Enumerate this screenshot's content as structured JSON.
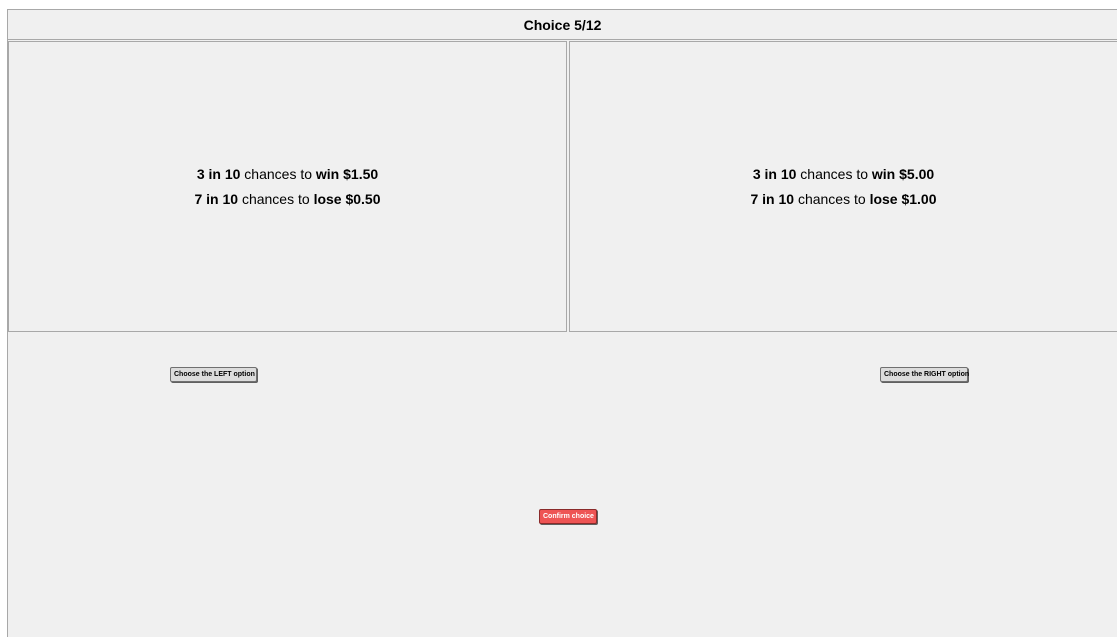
{
  "header": {
    "title": "Choice 5/12"
  },
  "left_option": {
    "win": {
      "odds": "3 in 10",
      "mid": " chances to ",
      "verb": "win",
      "amount": "$1.50"
    },
    "lose": {
      "odds": "7 in 10",
      "mid": " chances to ",
      "verb": "lose",
      "amount": "$0.50"
    }
  },
  "right_option": {
    "win": {
      "odds": "3 in 10",
      "mid": " chances to ",
      "verb": "win",
      "amount": "$5.00"
    },
    "lose": {
      "odds": "7 in 10",
      "mid": " chances to ",
      "verb": "lose",
      "amount": "$1.00"
    }
  },
  "buttons": {
    "choose_left": "Choose the LEFT option",
    "choose_right": "Choose the RIGHT option",
    "confirm": "Confirm choice"
  },
  "colors": {
    "confirm_button": "#ee5454",
    "background": "#f0f0f0"
  }
}
